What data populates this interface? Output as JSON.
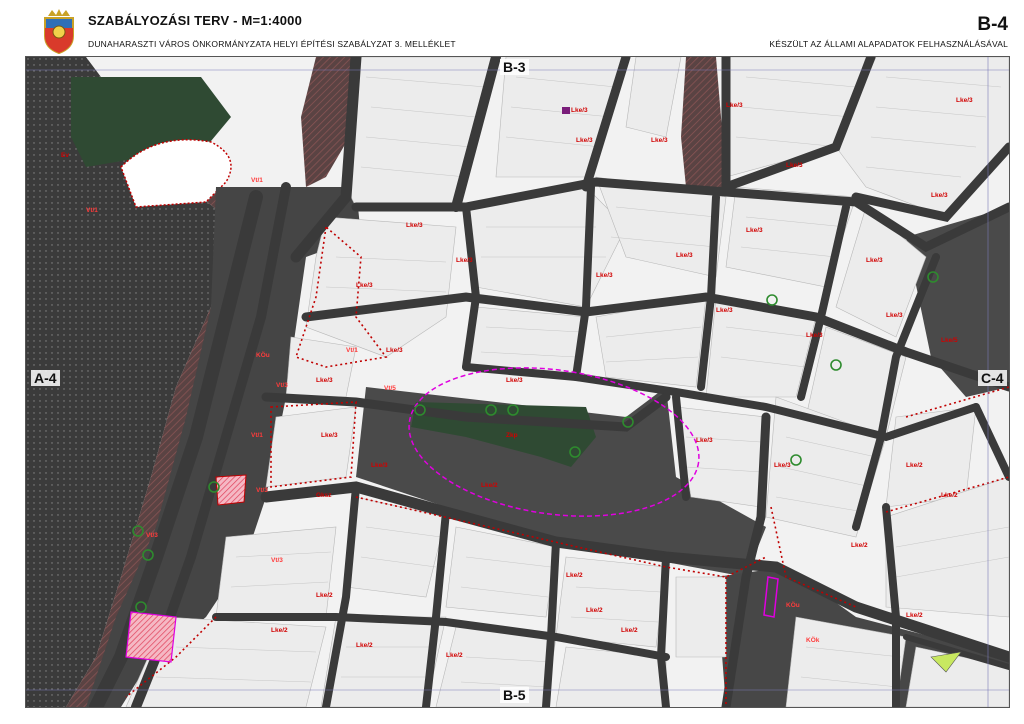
{
  "header": {
    "title": "SZABÁLYOZÁSI TERV   -   M=1:4000",
    "subtitle": "DUNAHARASZTI VÁROS ÖNKORMÁNYZATA HELYI ÉPÍTÉSI SZABÁLYZAT 3. MELLÉKLET",
    "sheet_id": "B-4",
    "basemap_note": "KÉSZÜLT AZ ÁLLAMI ALAPADATOK FELHASZNÁLÁSÁVAL",
    "crest_icon": "city-coat-of-arms-icon"
  },
  "map": {
    "adjacent_sheets": {
      "north": "B-3",
      "south": "B-5",
      "west": "A-4",
      "east": "C-4"
    },
    "zone_labels": [
      "Lke/3",
      "Lke/3",
      "Lke/3",
      "Lke/3",
      "Lke/3",
      "Lke/3",
      "Lke/3",
      "Lke/3",
      "Lke/3",
      "Lke/3",
      "Lke/3",
      "Lke/3",
      "Lke/3",
      "Lke/3",
      "Lke/3",
      "Lke/3",
      "Lke/3",
      "Lke/3",
      "Lke/3",
      "Lke/3",
      "Lke/3",
      "Lke/3",
      "Lke/3",
      "Lke/3",
      "Lke/2",
      "Lke/2",
      "Lke/2",
      "Lke/2",
      "Lke/2",
      "Lke/2",
      "Lke/2",
      "Lke/2",
      "Lke/2",
      "Lke/2",
      "Lke/2",
      "Lke/2",
      "Vt/1",
      "Vt/1",
      "Vt/1",
      "Vt/1",
      "Vt/3",
      "Vt/3",
      "Vt/3",
      "Vt/3",
      "Vt/5",
      "KÖu",
      "KÖu",
      "KÖk",
      "Zkp",
      "Gksz",
      "Ev",
      "Lke/5"
    ],
    "colors": {
      "road": "#3a3a3a",
      "dark_zone": "#4a4a4a",
      "green_area": "#2f4a33",
      "zone_text": "#d10000",
      "boundary": "#c00000",
      "conservation_ellipse": "#e000e0",
      "protected_area": "#e066e0"
    }
  }
}
